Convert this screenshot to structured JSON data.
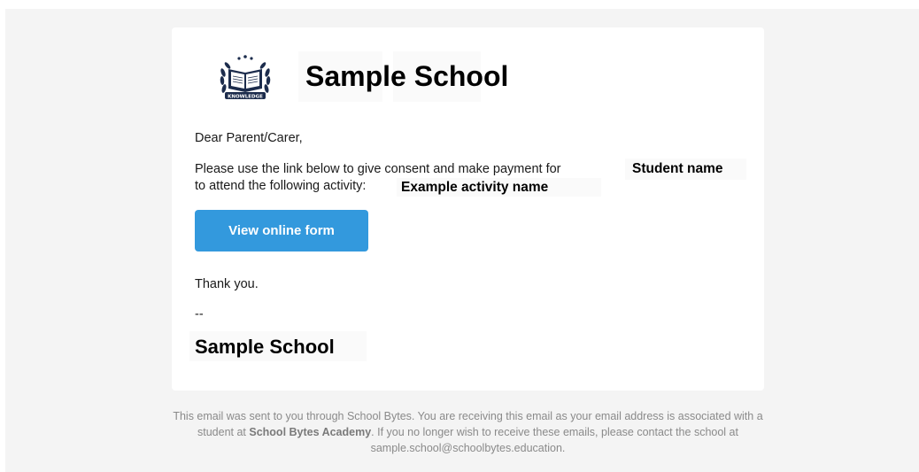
{
  "email": {
    "school_name": "Sample School",
    "greeting": "Dear Parent/Carer,",
    "body_line1": "Please use the link below to give consent and make payment for",
    "student_name": "Student name",
    "body_line2": "to attend the following activity:",
    "activity_name": "Example activity name",
    "button_label": "View online form",
    "thanks": "Thank you.",
    "separator": "--",
    "signature": "Sample School",
    "logo_text": "KNOWLEDGE"
  },
  "footer": {
    "part1": "This email was sent to you through School Bytes. You are receiving this email as your email address is associated with a student at ",
    "academy": "School Bytes Academy",
    "part2": ". If you no longer wish to receive these emails, please contact the school at sample.school@schoolbytes.education."
  },
  "colors": {
    "button": "#3399dd",
    "background": "#f4f4f4",
    "logo_navy": "#1c2c4c"
  }
}
